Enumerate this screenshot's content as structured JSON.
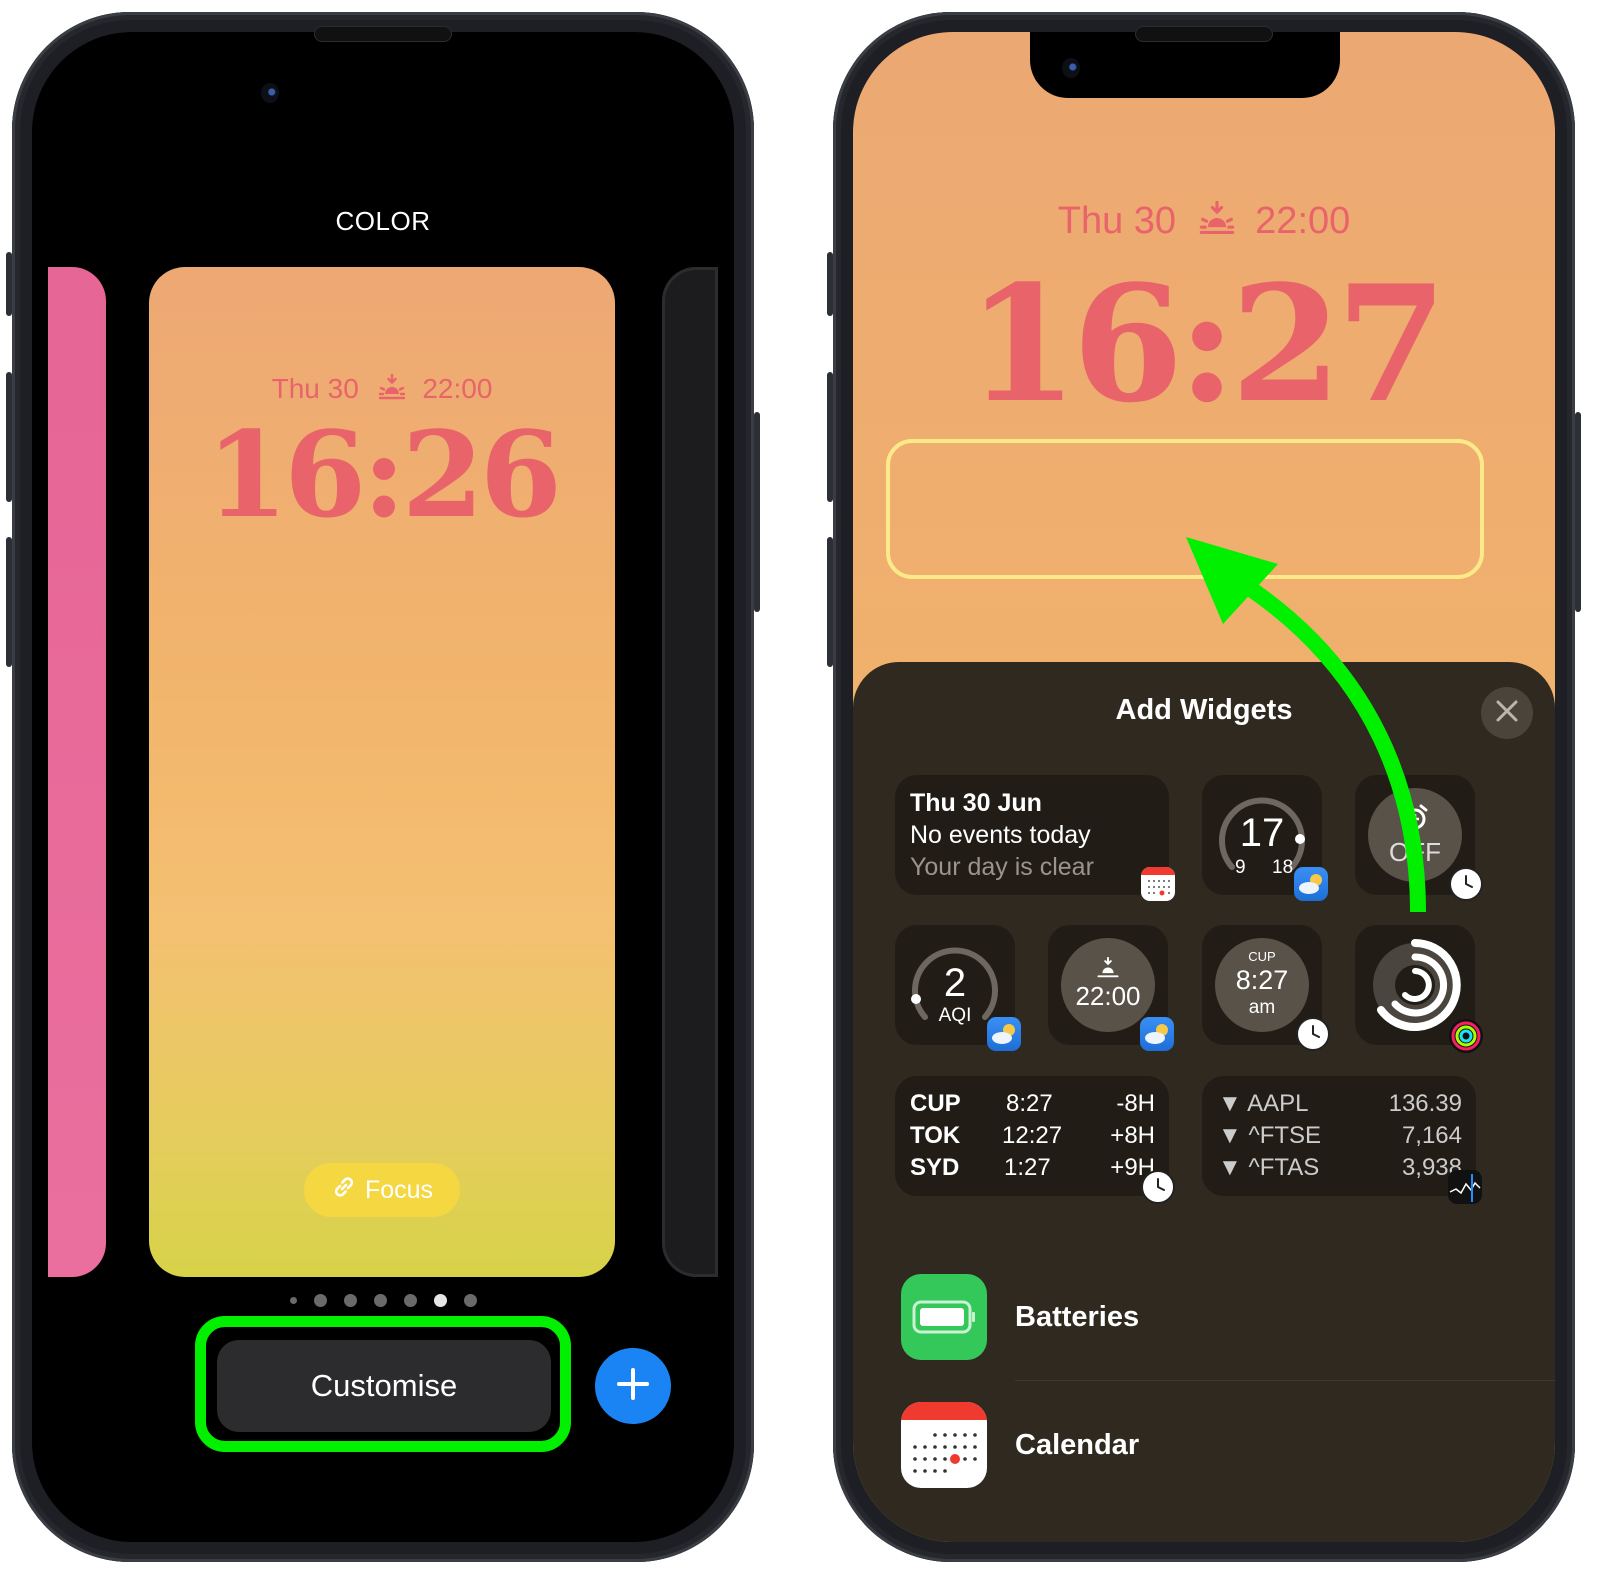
{
  "left_phone": {
    "mode_title": "COLOR",
    "lock_preview": {
      "date": "Thu 30",
      "sunset_time": "22:00",
      "time": "16:26"
    },
    "focus_label": "Focus",
    "page_dots": {
      "count": 7,
      "active_index": 5
    },
    "customise_label": "Customise",
    "add_button_icon": "plus-icon"
  },
  "right_phone": {
    "lock": {
      "date": "Thu 30",
      "sunset_time": "22:00",
      "time": "16:27"
    },
    "sheet": {
      "title": "Add Widgets",
      "close_icon": "close-icon",
      "calendar_widget": {
        "date": "Thu 30 Jun",
        "line1": "No events today",
        "line2": "Your day is clear"
      },
      "temperature_widget": {
        "current": "17",
        "low": "9",
        "high": "18"
      },
      "alarm_widget": {
        "label": "OFF"
      },
      "aqi_widget": {
        "value": "2",
        "label": "AQI"
      },
      "sunset_widget": {
        "time": "22:00"
      },
      "world_clock_widget": {
        "city": "CUP",
        "time": "8:27",
        "ampm": "am"
      },
      "world_clock_list": [
        {
          "city": "CUP",
          "time": "8:27",
          "offset": "-8H"
        },
        {
          "city": "TOK",
          "time": "12:27",
          "offset": "+8H"
        },
        {
          "city": "SYD",
          "time": "1:27",
          "offset": "+9H"
        }
      ],
      "stocks_list": [
        {
          "symbol": "AAPL",
          "value": "136.39"
        },
        {
          "symbol": "^FTSE",
          "value": "7,164"
        },
        {
          "symbol": "^FTAS",
          "value": "3,938"
        }
      ],
      "apps": [
        {
          "name": "Batteries"
        },
        {
          "name": "Calendar"
        }
      ]
    }
  },
  "colors": {
    "lock_text": "#e8646a",
    "highlight_green": "#00f000",
    "accent_blue": "#1a84f5",
    "sheet_bg": "#2f2920",
    "widget_slot_border": "#fbe98a"
  }
}
